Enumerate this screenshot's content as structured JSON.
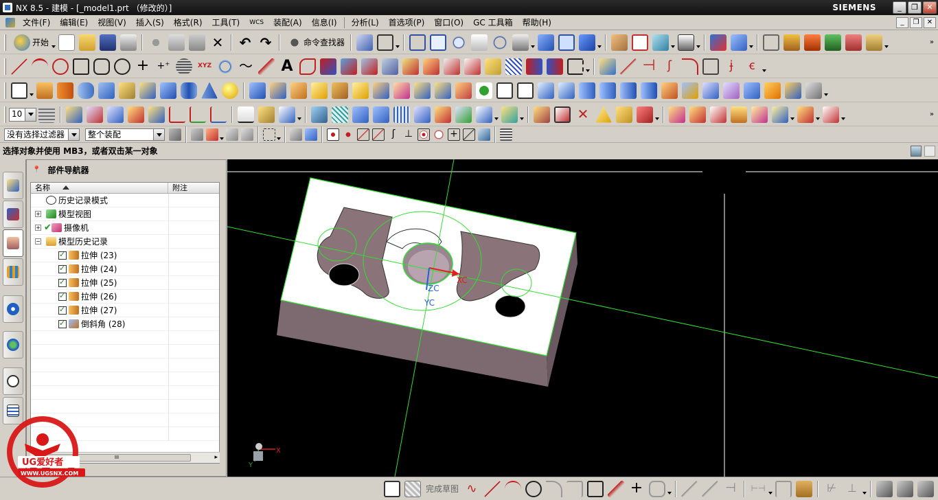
{
  "titlebar": {
    "title": "NX 8.5 - 建模 - [_model1.prt （修改的）]",
    "brand": "SIEMENS",
    "minimize": "_",
    "maximize": "❐",
    "close": "✕"
  },
  "menubar": {
    "items": [
      "文件(F)",
      "编辑(E)",
      "视图(V)",
      "插入(S)",
      "格式(R)",
      "工具(T)",
      "WCS",
      "装配(A)",
      "信息(I)",
      "分析(L)",
      "首选项(P)",
      "窗口(O)",
      "GC 工具箱",
      "帮助(H)"
    ]
  },
  "toolbar1": {
    "start_label": "开始",
    "command_finder_label": "命令查找器"
  },
  "toolbar4": {
    "layer_value": "10"
  },
  "selection_bar": {
    "filter_value": "没有选择过滤器",
    "scope_value": "整个装配"
  },
  "cue_line": "选择对象并使用 MB3，或者双击某一对象",
  "navigator": {
    "title": "部件导航器",
    "col_name": "名称",
    "col_note": "附注",
    "rows": [
      {
        "label": "历史记录模式",
        "expander": ""
      },
      {
        "label": "模型视图",
        "expander": "+"
      },
      {
        "label": "摄像机",
        "expander": "+"
      },
      {
        "label": "模型历史记录",
        "expander": "−"
      },
      {
        "label": "拉伸 (23)"
      },
      {
        "label": "拉伸 (24)"
      },
      {
        "label": "拉伸 (25)"
      },
      {
        "label": "拉伸 (26)"
      },
      {
        "label": "拉伸 (27)"
      },
      {
        "label": "倒斜角 (28)"
      }
    ],
    "scroll_grip": "III"
  },
  "viewport": {
    "axis_x": "XC",
    "axis_y": "YC",
    "axis_z": "ZC",
    "triad_x": "X",
    "triad_y": "Y"
  },
  "bottombar": {
    "finish_sketch_label": "完成草图"
  },
  "watermark": {
    "line1": "UG爱好者",
    "line2": "WWW.UGSNX.COM"
  },
  "colors": {
    "viewport_bg": "#000000",
    "part_top": "#ffffff",
    "part_side": "#7d6a70",
    "sketch_green": "#33dd33",
    "x_axis_red": "#e02020",
    "y_axis_blue": "#2060e0"
  }
}
